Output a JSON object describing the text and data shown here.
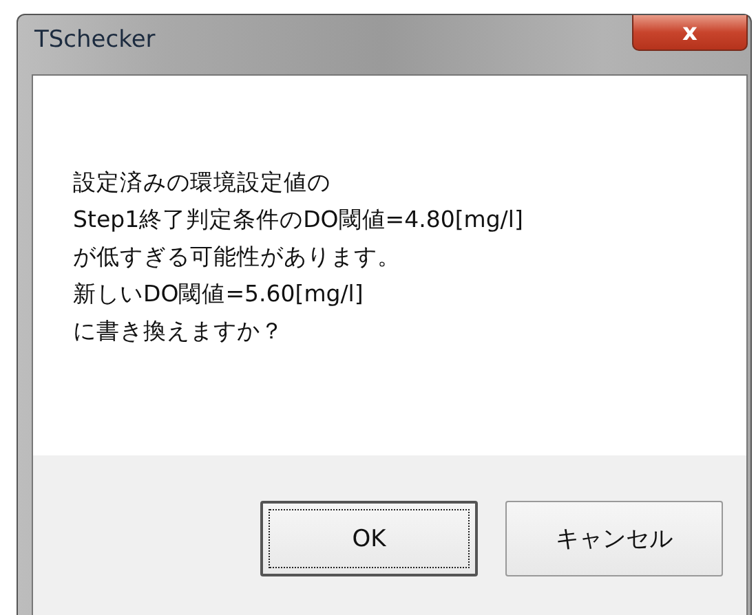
{
  "window": {
    "title": "TSchecker",
    "close_glyph": "x"
  },
  "message": [
    "設定済みの環境設定値の",
    "Step1終了判定条件のDO閾値=4.80[mg/l]",
    "が低すぎる可能性があります。",
    "新しいDO閾値=5.60[mg/l]",
    "に書き換えますか？"
  ],
  "buttons": [
    {
      "label": "OK",
      "focused": true
    },
    {
      "label": "キャンセル",
      "focused": false
    }
  ]
}
